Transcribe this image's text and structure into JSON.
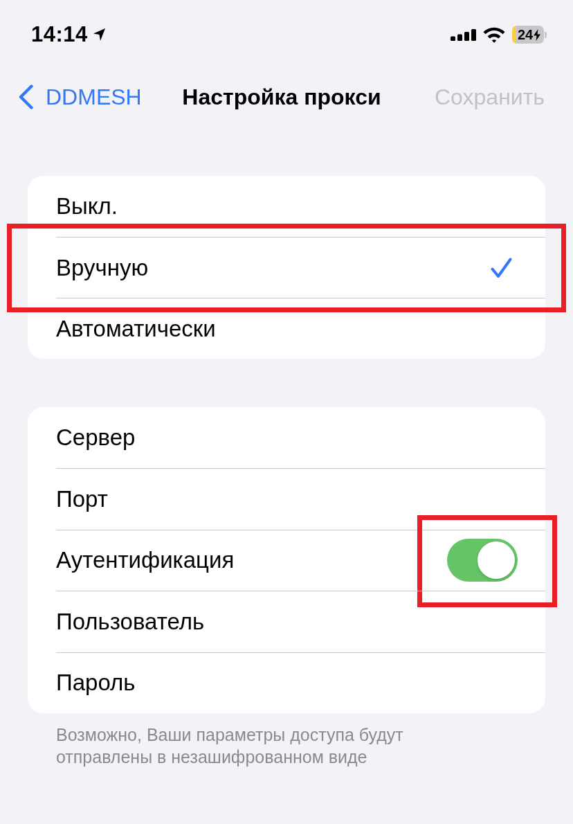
{
  "status_bar": {
    "time": "14:14",
    "battery": {
      "text": "24",
      "charging": true
    }
  },
  "nav_bar": {
    "back": {
      "label": "DDMESH"
    },
    "title": "Настройка прокси",
    "action": {
      "label": "Сохранить",
      "disabled": true
    }
  },
  "mode_options": [
    {
      "label": "Выкл.",
      "selected": false,
      "highlighted": false
    },
    {
      "label": "Вручную",
      "selected": true,
      "highlighted": true
    },
    {
      "label": "Автоматически",
      "selected": false,
      "highlighted": false
    }
  ],
  "settings": [
    {
      "kind": "plain",
      "label": "Сервер",
      "highlighted": false
    },
    {
      "kind": "plain",
      "label": "Порт",
      "highlighted": false
    },
    {
      "kind": "toggle",
      "label": "Аутентификация",
      "on": true,
      "highlighted": true
    },
    {
      "kind": "plain",
      "label": "Пользователь",
      "highlighted": false
    },
    {
      "kind": "plain",
      "label": "Пароль",
      "highlighted": false
    }
  ],
  "footer_note": "Возможно, Ваши параметры доступа будут отправлены в незашифрованном виде"
}
